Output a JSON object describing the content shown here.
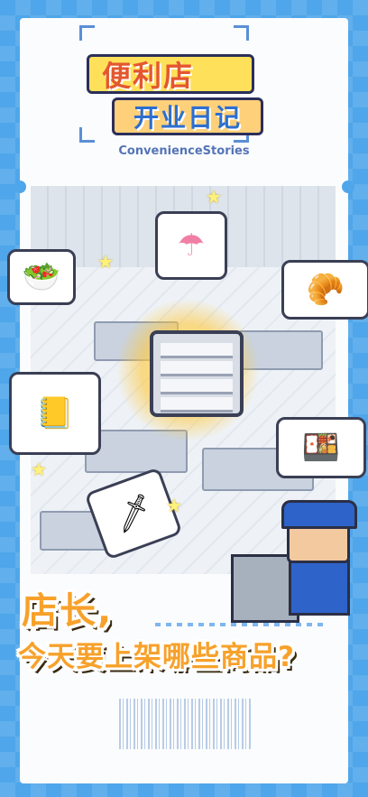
{
  "logo": {
    "line1": "便利店",
    "line2": "开业日记",
    "subtitle": "ConvenienceStories"
  },
  "scene": {
    "bubbles": [
      {
        "name": "umbrella",
        "icon": "☂"
      },
      {
        "name": "salad",
        "icon": "🥗"
      },
      {
        "name": "bread",
        "icon": "🥐"
      },
      {
        "name": "notebook",
        "icon": "📒"
      },
      {
        "name": "bento",
        "icon": "🍱"
      },
      {
        "name": "sword",
        "icon": "🗡"
      }
    ]
  },
  "headline": {
    "line1": "店长,",
    "line2": "今天要上架哪些商品?"
  },
  "colors": {
    "background": "#4fa6ea",
    "headline": "#f7a12b",
    "ticket": "#fbfcfd"
  }
}
